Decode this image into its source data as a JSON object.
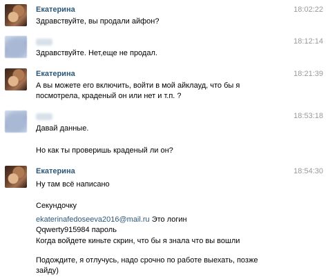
{
  "messages": [
    {
      "sender": "Екатерина",
      "time": "18:02:22",
      "lines": [
        "Здравствуйте, вы продали айфон?"
      ]
    },
    {
      "sender": "",
      "time": "18:12:14",
      "lines": [
        "Здравствуйте. Нет,еще не продал."
      ]
    },
    {
      "sender": "Екатерина",
      "time": "18:21:39",
      "lines": [
        "А вы можете его включить, войти в мой айклауд, что бы я",
        "посмотрела, краденый он или нет и т.п. ?"
      ]
    },
    {
      "sender": "",
      "time": "18:53:18",
      "lines": [
        "Давай данные.",
        "Но как ты проверишь краденый ли он?"
      ]
    },
    {
      "sender": "Екатерина",
      "time": "18:54:30",
      "lines": [
        "Ну там всё написано",
        "Секундочку",
        "ekaterinafedoseeva2016@mail.ru",
        "Это логин",
        "Qqwerty915984 пароль",
        "Когда войдете киньте скрин, что бы я знала что вы вошли",
        "Подождите, я отлучусь, надо срочно по работе выехать, позже",
        "зайду)"
      ]
    }
  ]
}
